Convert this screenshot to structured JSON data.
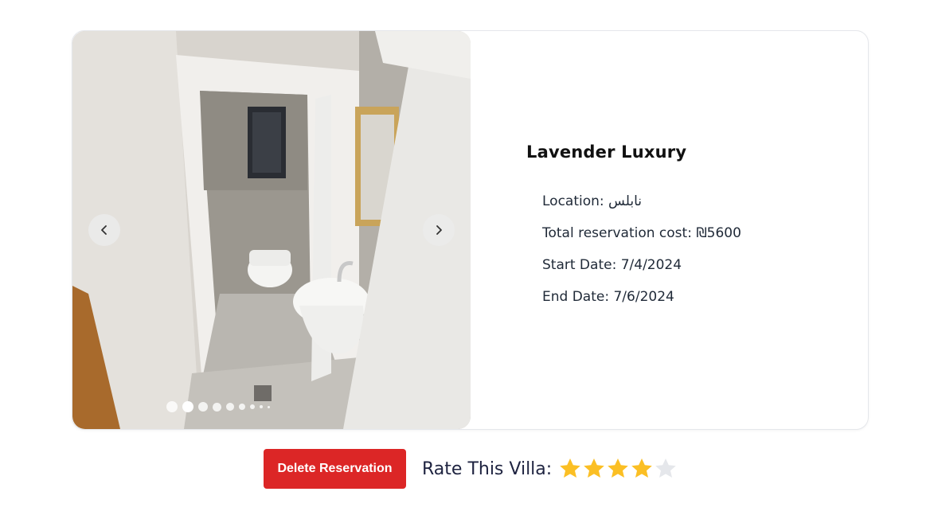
{
  "villa": {
    "title": "Lavender Luxury",
    "location_label": "Location:",
    "location_value": "نابلس",
    "cost_label": "Total reservation cost:",
    "cost_value": "₪5600",
    "start_label": "Start Date:",
    "start_value": "7/4/2024",
    "end_label": "End Date:",
    "end_value": "7/6/2024"
  },
  "carousel": {
    "image_count": 9,
    "active_index": 1,
    "prev_icon": "chevron-left-icon",
    "next_icon": "chevron-right-icon"
  },
  "actions": {
    "delete_label": "Delete Reservation",
    "rate_label": "Rate This Villa:",
    "rating": 4,
    "max_rating": 5
  },
  "colors": {
    "delete": "#dc2626",
    "star_filled": "#fbbf24",
    "star_empty": "#e5e7eb"
  }
}
